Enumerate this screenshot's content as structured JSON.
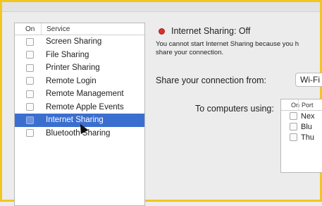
{
  "service_list": {
    "header_on": "On",
    "header_service": "Service",
    "items": [
      {
        "label": "Screen Sharing",
        "checked": false,
        "selected": false
      },
      {
        "label": "File Sharing",
        "checked": false,
        "selected": false
      },
      {
        "label": "Printer Sharing",
        "checked": false,
        "selected": false
      },
      {
        "label": "Remote Login",
        "checked": false,
        "selected": false
      },
      {
        "label": "Remote Management",
        "checked": false,
        "selected": false
      },
      {
        "label": "Remote Apple Events",
        "checked": false,
        "selected": false
      },
      {
        "label": "Internet Sharing",
        "checked": false,
        "selected": true
      },
      {
        "label": "Bluetooth Sharing",
        "checked": false,
        "selected": false
      }
    ]
  },
  "status": {
    "title": "Internet Sharing: Off",
    "indicator_color": "#d8322d",
    "notice_line1": "You cannot start Internet Sharing because you h",
    "notice_line2": "share your connection."
  },
  "share_from": {
    "label": "Share your connection from:",
    "value": "Wi-Fi"
  },
  "to_computers": {
    "label": "To computers using:",
    "header_on": "On",
    "header_ports": "Port",
    "rows": [
      {
        "label": "Nex",
        "checked": false
      },
      {
        "label": "Blu",
        "checked": false
      },
      {
        "label": "Thu",
        "checked": false
      }
    ]
  },
  "colors": {
    "highlight": "#3b6fcf",
    "frame": "#f3c51f"
  }
}
